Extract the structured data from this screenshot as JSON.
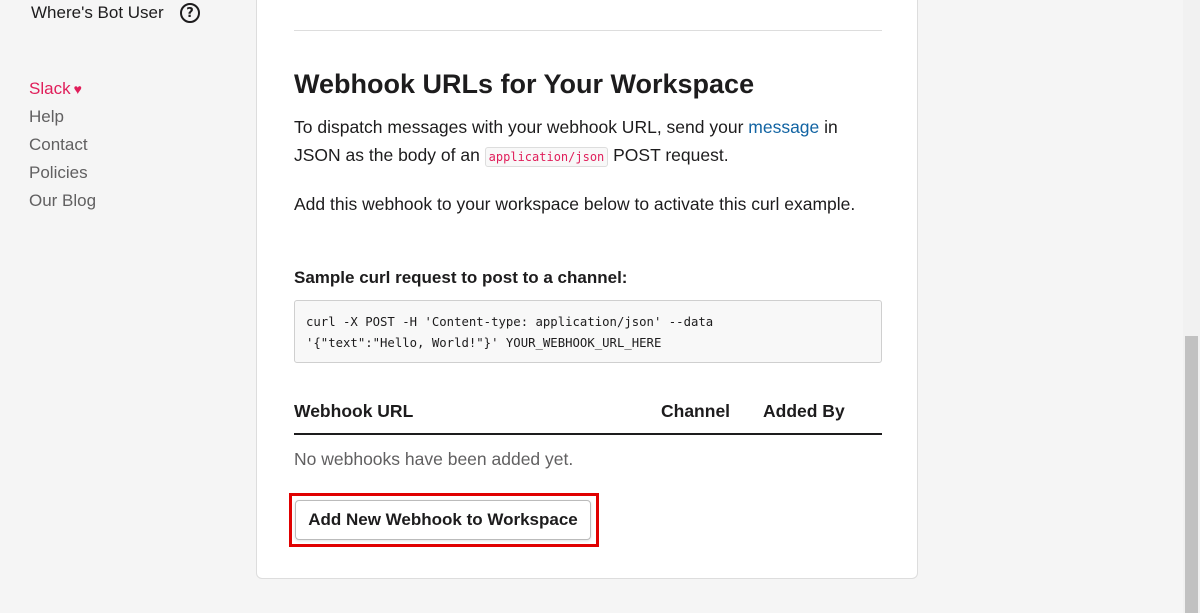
{
  "sidebar": {
    "bot_user": "Where's Bot User",
    "help_icon": "?",
    "footer": [
      {
        "label": "Slack",
        "icon": "heart-icon"
      },
      {
        "label": "Help"
      },
      {
        "label": "Contact"
      },
      {
        "label": "Policies"
      },
      {
        "label": "Our Blog"
      }
    ]
  },
  "main": {
    "title": "Webhook URLs for Your Workspace",
    "p1": {
      "before": "To dispatch messages with your webhook URL, send your ",
      "link": "message",
      "mid": " in JSON as the body of an ",
      "code": "application/json",
      "after": " POST request."
    },
    "p2": "Add this webhook to your workspace below to activate this curl example.",
    "sample_label": "Sample curl request to post to a channel:",
    "code_lines": [
      "curl -X POST -H 'Content-type: application/json' --data",
      "'{\"text\":\"Hello, World!\"}' YOUR_WEBHOOK_URL_HERE"
    ],
    "table": {
      "headers": [
        "Webhook URL",
        "Channel",
        "Added By"
      ],
      "empty_text": "No webhooks have been added yet."
    },
    "add_button": "Add New Webhook to Workspace"
  },
  "colors": {
    "accent": "#e01e5a",
    "link": "#1264a3",
    "highlight": "#e00000"
  }
}
